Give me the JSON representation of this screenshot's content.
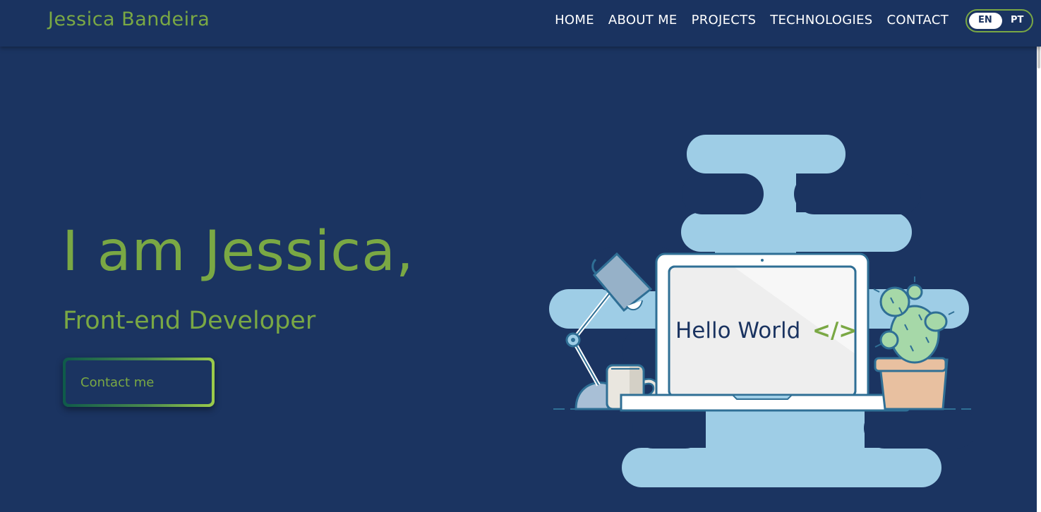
{
  "navbar": {
    "brand": "Jessica Bandeira",
    "links": [
      "HOME",
      "ABOUT ME",
      "PROJECTS",
      "TECHNOLOGIES",
      "CONTACT"
    ],
    "language": {
      "selected": "EN",
      "options": [
        "EN",
        "PT"
      ]
    }
  },
  "hero": {
    "title": "I am Jessica,",
    "subtitle": "Front-end Developer",
    "cta_label": "Contact me"
  },
  "illustration": {
    "screen_text": "Hello World",
    "code_symbol": "</>"
  },
  "colors": {
    "background": "#1b3461",
    "accent_green": "#7aa844",
    "blob_blue": "#9ecde6",
    "white": "#ffffff"
  }
}
